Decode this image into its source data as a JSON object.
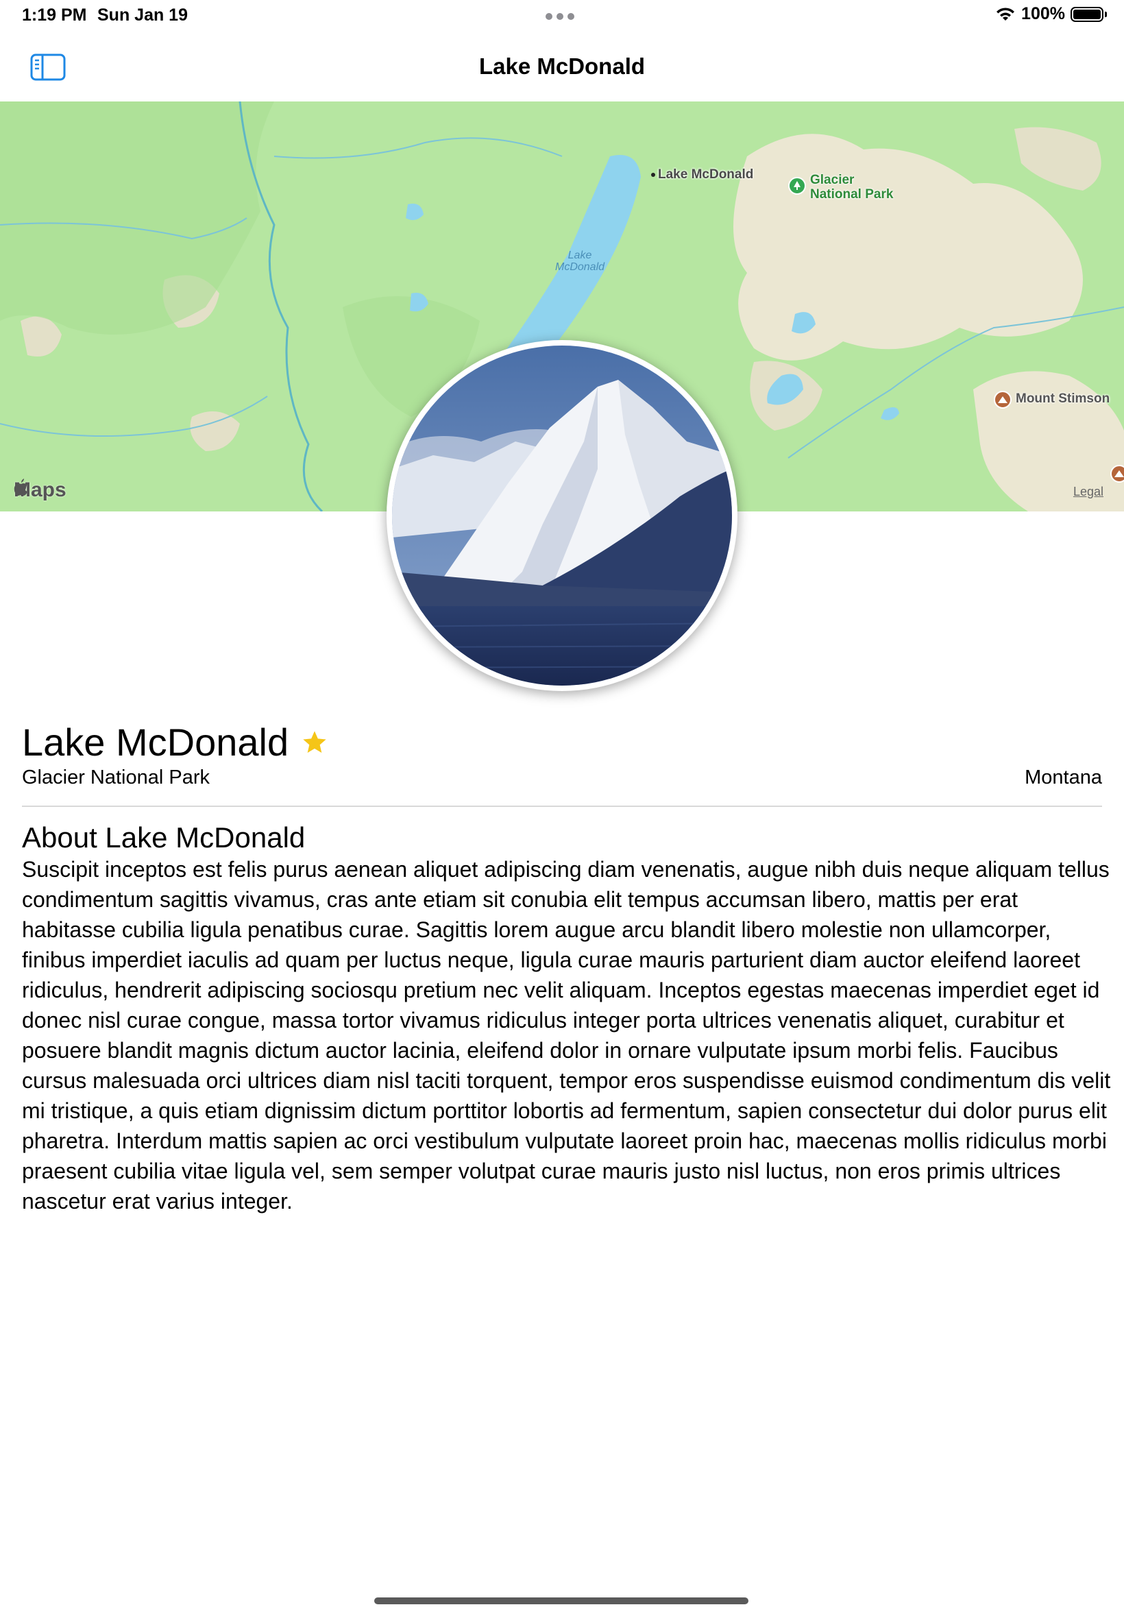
{
  "status_bar": {
    "time": "1:19 PM",
    "date": "Sun Jan 19",
    "battery": "100%"
  },
  "nav": {
    "title": "Lake McDonald"
  },
  "map": {
    "labels": {
      "lake_pin": "Lake McDonald",
      "lake_water_line1": "Lake",
      "lake_water_line2": "McDonald",
      "park_line1": "Glacier",
      "park_line2": "National Park",
      "mountain": "Mount Stimson"
    },
    "attribution": "Maps",
    "legal": "Legal",
    "colors": {
      "land": "#b6e6a1",
      "water": "#8fd3ee",
      "highland": "#e8e4cf"
    }
  },
  "place": {
    "name": "Lake McDonald",
    "park": "Glacier National Park",
    "state": "Montana",
    "is_favorite": true,
    "favorite_color": "#f5c518"
  },
  "about": {
    "heading": "About Lake McDonald",
    "body": "Suscipit inceptos est felis purus aenean aliquet adipiscing diam venenatis, augue nibh duis neque aliquam tellus condimentum sagittis vivamus, cras ante etiam sit conubia elit tempus accumsan libero, mattis per erat habitasse cubilia ligula penatibus curae. Sagittis lorem augue arcu blandit libero molestie non ullamcorper, finibus imperdiet iaculis ad quam per luctus neque, ligula curae mauris parturient diam auctor eleifend laoreet ridiculus, hendrerit adipiscing sociosqu pretium nec velit aliquam. Inceptos egestas maecenas imperdiet eget id donec nisl curae congue, massa tortor vivamus ridiculus integer porta ultrices venenatis aliquet, curabitur et posuere blandit magnis dictum auctor lacinia, eleifend dolor in ornare vulputate ipsum morbi felis. Faucibus cursus malesuada orci ultrices diam nisl taciti torquent, tempor eros suspendisse euismod condimentum dis velit mi tristique, a quis etiam dignissim dictum porttitor lobortis ad fermentum, sapien consectetur dui dolor purus elit pharetra. Interdum mattis sapien ac orci vestibulum vulputate laoreet proin hac, maecenas mollis ridiculus morbi praesent cubilia vitae ligula vel, sem semper volutpat curae mauris justo nisl luctus, non eros primis ultrices nascetur erat varius integer."
  },
  "accent_color": "#1e88e5"
}
